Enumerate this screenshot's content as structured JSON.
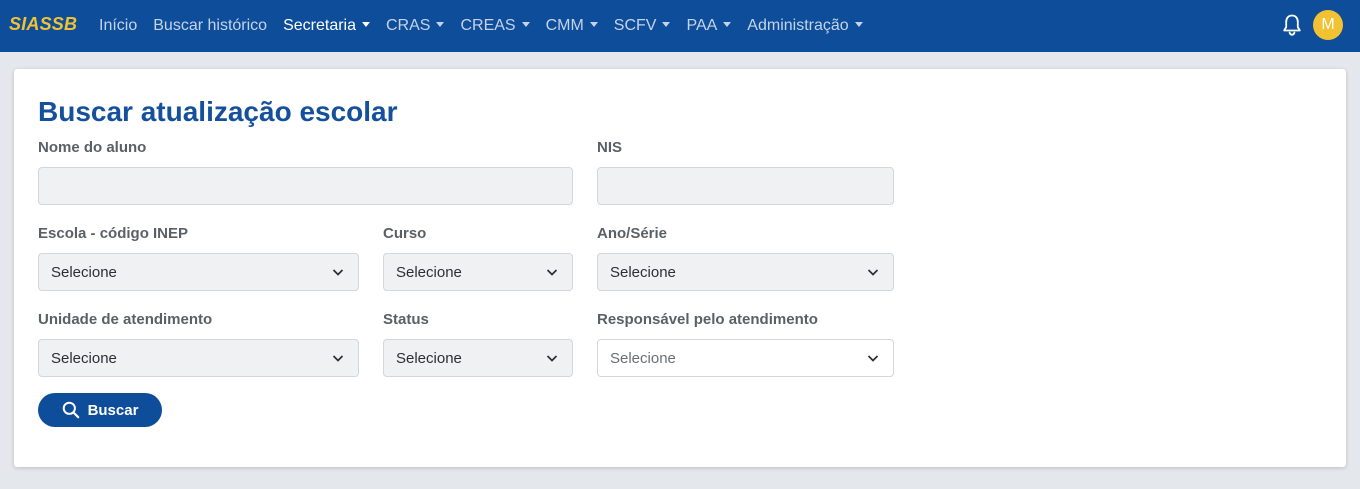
{
  "navbar": {
    "brand": "SIASSB",
    "items": [
      {
        "label": "Início",
        "dropdown": false,
        "active": false
      },
      {
        "label": "Buscar histórico",
        "dropdown": false,
        "active": false
      },
      {
        "label": "Secretaria",
        "dropdown": true,
        "active": true
      },
      {
        "label": "CRAS",
        "dropdown": true,
        "active": false
      },
      {
        "label": "CREAS",
        "dropdown": true,
        "active": false
      },
      {
        "label": "CMM",
        "dropdown": true,
        "active": false
      },
      {
        "label": "SCFV",
        "dropdown": true,
        "active": false
      },
      {
        "label": "PAA",
        "dropdown": true,
        "active": false
      },
      {
        "label": "Administração",
        "dropdown": true,
        "active": false
      }
    ],
    "bell_icon": "bell-icon",
    "avatar_initial": "M"
  },
  "form": {
    "title": "Buscar atualização escolar",
    "fields": {
      "nome": {
        "label": "Nome do aluno",
        "value": ""
      },
      "nis": {
        "label": "NIS",
        "value": ""
      },
      "escola": {
        "label": "Escola - código INEP",
        "value": "Selecione"
      },
      "curso": {
        "label": "Curso",
        "value": "Selecione"
      },
      "ano": {
        "label": "Ano/Série",
        "value": "Selecione"
      },
      "unidade": {
        "label": "Unidade de atendimento",
        "value": "Selecione"
      },
      "status": {
        "label": "Status",
        "value": "Selecione"
      },
      "responsavel": {
        "label": "Responsável pelo atendimento",
        "value": "Selecione"
      }
    },
    "search_button": "Buscar"
  },
  "colors": {
    "navbar_bg": "#0d4d99",
    "brand": "#f2c232",
    "title": "#14509b",
    "button_bg": "#0d4d99"
  }
}
